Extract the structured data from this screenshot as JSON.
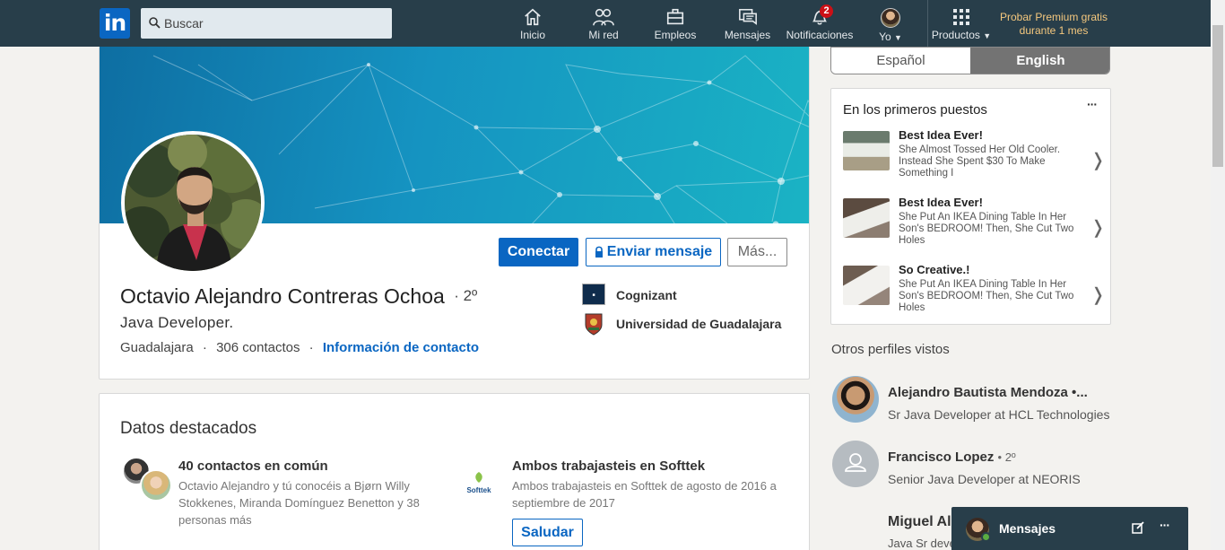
{
  "nav": {
    "logo_text": "in",
    "search_placeholder": "Buscar",
    "items": [
      {
        "label": "Inicio",
        "icon": "home-icon"
      },
      {
        "label": "Mi red",
        "icon": "network-icon"
      },
      {
        "label": "Empleos",
        "icon": "briefcase-icon"
      },
      {
        "label": "Mensajes",
        "icon": "messages-icon"
      },
      {
        "label": "Notificaciones",
        "icon": "bell-icon",
        "badge": "2"
      },
      {
        "label": "Yo",
        "icon": "avatar"
      },
      {
        "label": "Productos",
        "icon": "grid-icon"
      }
    ],
    "premium": "Probar Premium gratis durante 1 mes"
  },
  "profile": {
    "name": "Octavio Alejandro Contreras Ochoa",
    "degree": "· 2º",
    "headline": "Java Developer.",
    "location": "Guadalajara",
    "connections": "306 contactos",
    "contact_info": "Información de contacto",
    "buttons": {
      "connect": "Conectar",
      "message": "Enviar mensaje",
      "more": "Más..."
    },
    "company": "Cognizant",
    "school": "Universidad de Guadalajara"
  },
  "highlights": {
    "title": "Datos destacados",
    "shared_connections": {
      "title": "40 contactos en común",
      "desc": "Octavio Alejandro y tú conocéis a Bjørn Willy Stokkenes, Miranda Domínguez Benetton y 38 personas más"
    },
    "worked_together": {
      "title": "Ambos trabajasteis en Softtek",
      "desc": "Ambos trabajasteis en Softtek de agosto de 2016 a septiembre de 2017",
      "logo_text": "Softtek",
      "button": "Saludar"
    }
  },
  "language": {
    "options": [
      "Español",
      "English"
    ],
    "selected": "English"
  },
  "ads": {
    "heading": "En los primeros puestos",
    "more": "···",
    "items": [
      {
        "title": "Best Idea Ever!",
        "desc": "She Almost Tossed Her Old Cooler. Instead She Spent $30 To Make Something I"
      },
      {
        "title": "Best Idea Ever!",
        "desc": "She Put An IKEA Dining Table In Her Son's BEDROOM! Then, She Cut Two Holes"
      },
      {
        "title": "So Creative.!",
        "desc": "She Put An IKEA Dining Table In Her Son's BEDROOM! Then, She Cut Two Holes"
      }
    ]
  },
  "people_also_viewed": {
    "heading": "Otros perfiles vistos",
    "people": [
      {
        "name": "Alejandro Bautista Mendoza •...",
        "degree": "",
        "title": "Sr Java Developer at HCL Technologies"
      },
      {
        "name": "Francisco Lopez",
        "degree": "• 2º",
        "title": "Senior Java Developer at NEORIS"
      },
      {
        "name": "Miguel Al",
        "degree": "",
        "title": "Java Sr deve"
      }
    ]
  },
  "messaging": {
    "label": "Mensajes"
  },
  "colors": {
    "nav_bg": "#283e4a",
    "brand": "#0a66c2",
    "premium": "#f5c87e",
    "badge": "#cc1016"
  }
}
